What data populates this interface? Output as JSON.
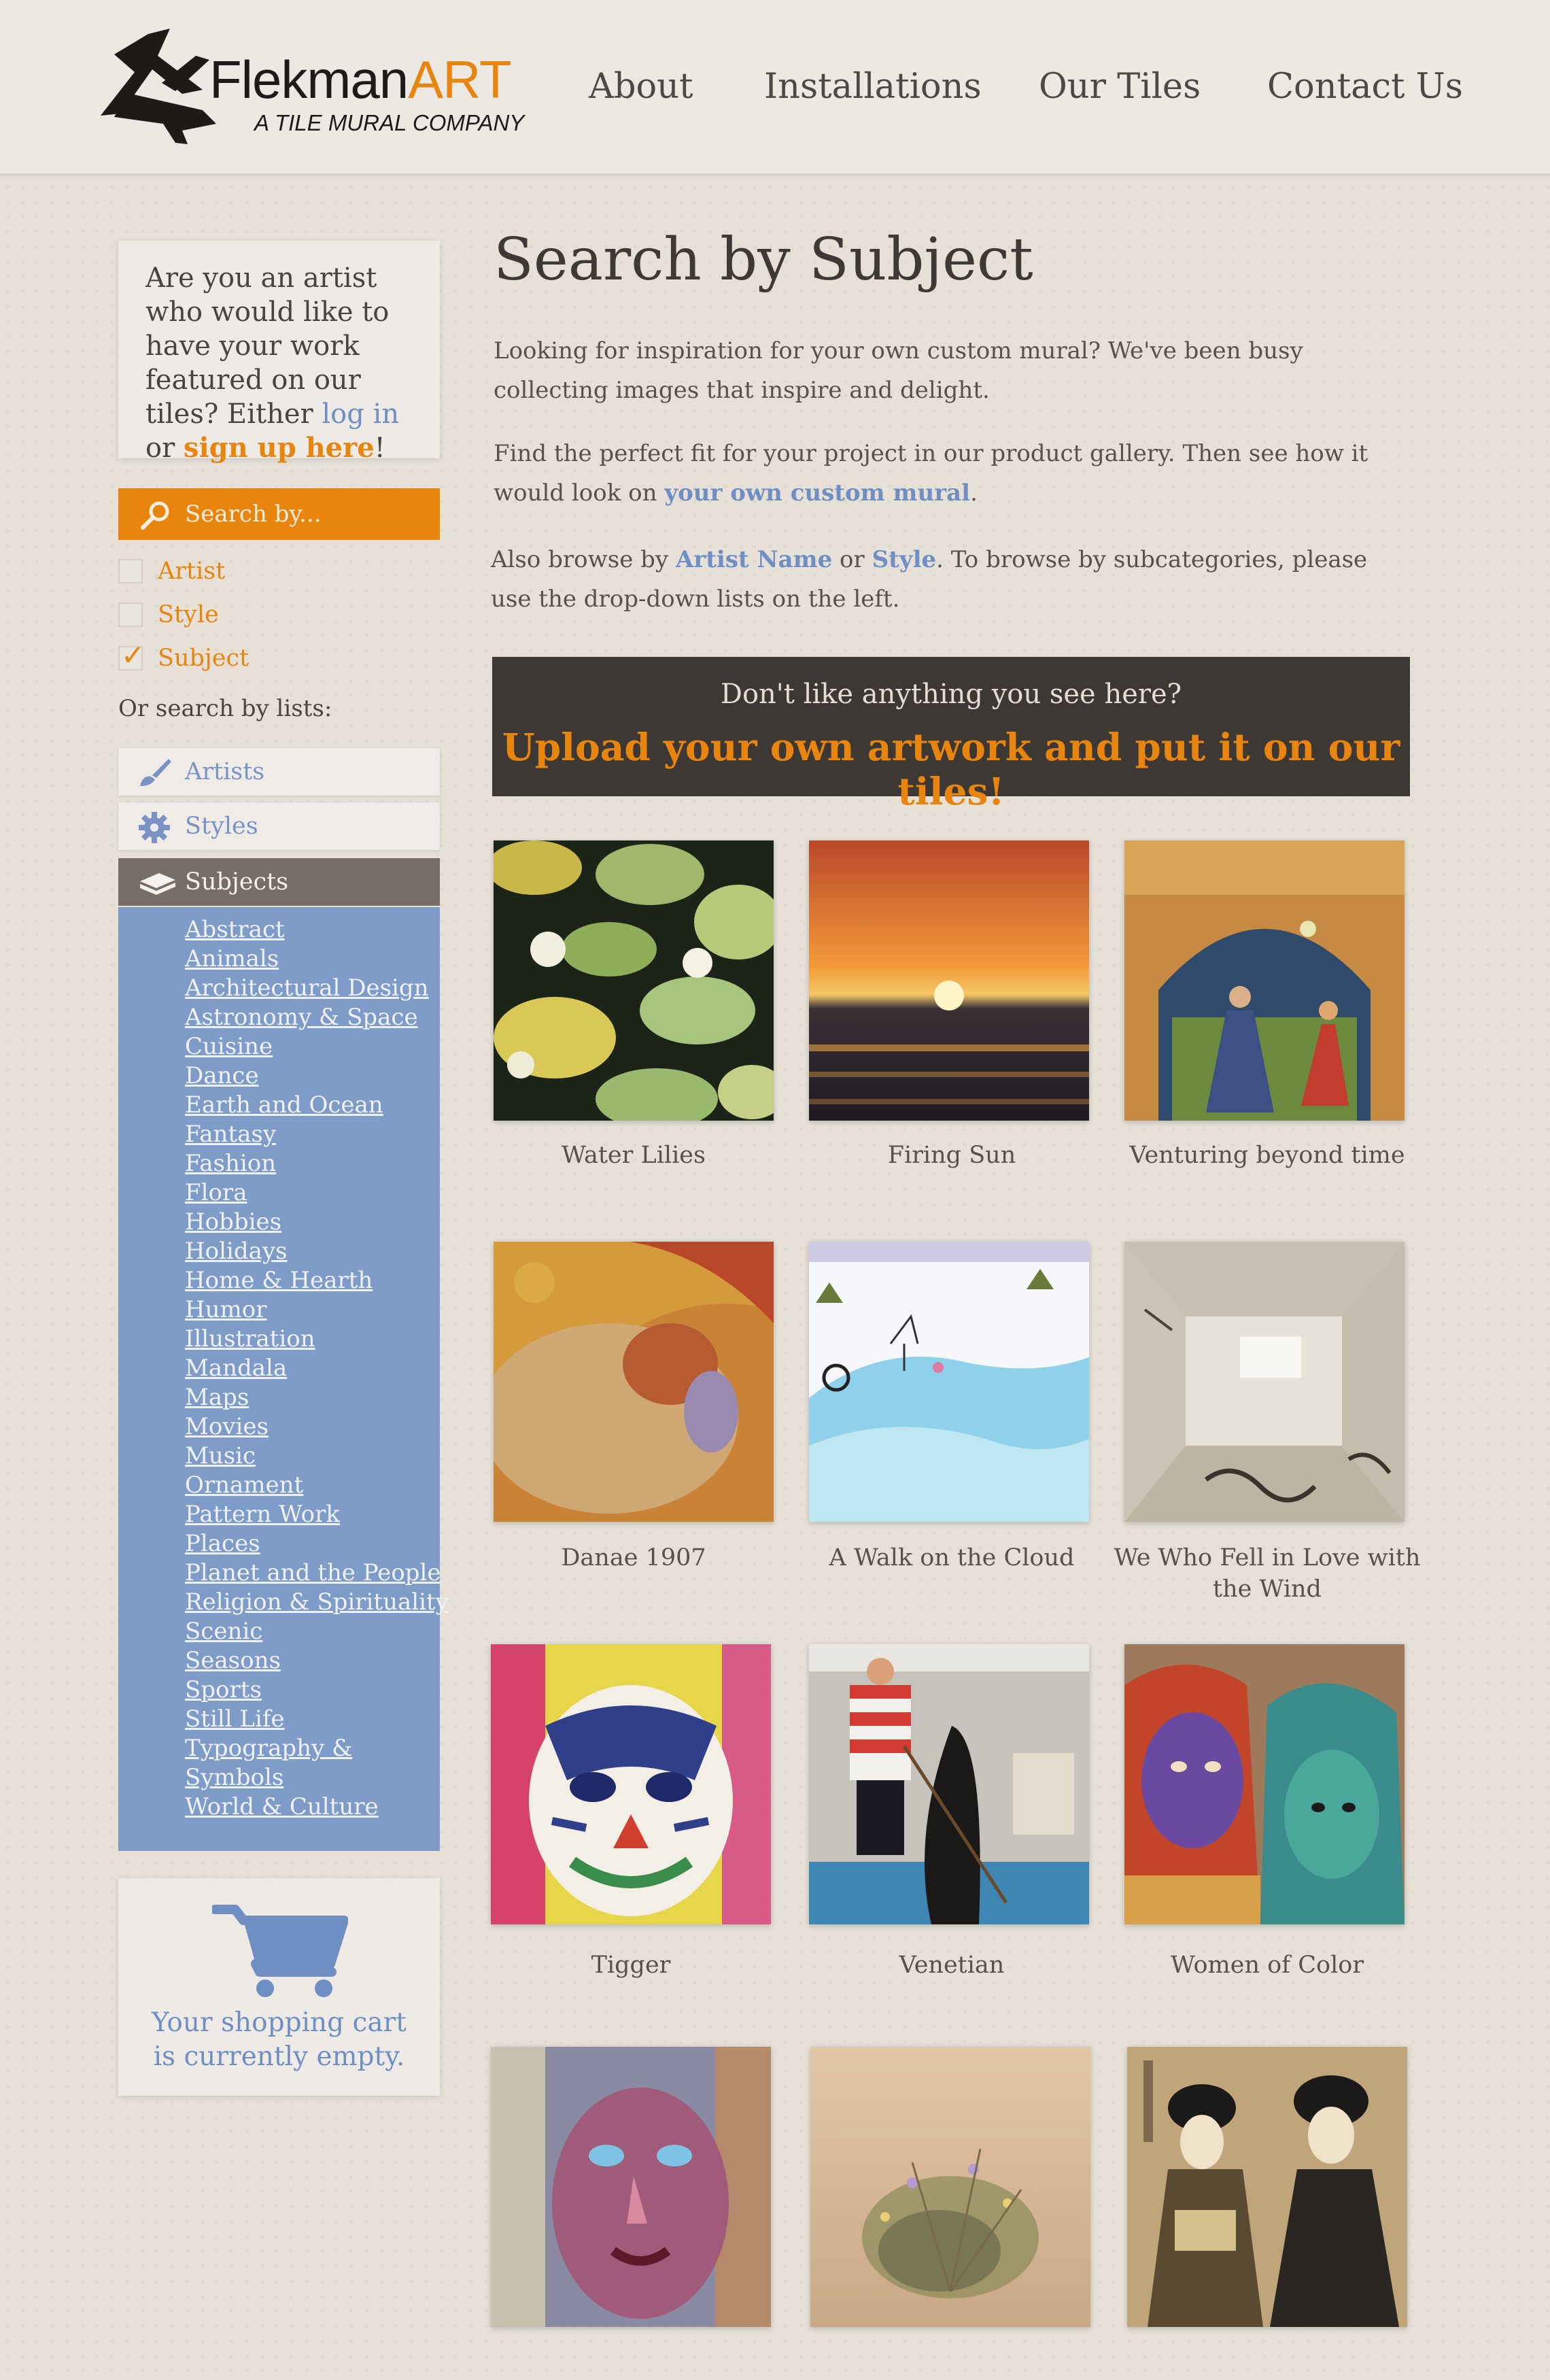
{
  "brand": {
    "name_part1": "Flekman",
    "name_part2": "ART",
    "tagline": "A TILE MURAL COMPANY"
  },
  "nav": {
    "items": [
      "About",
      "Installations",
      "Our Tiles",
      "Contact Us"
    ]
  },
  "artist_prompt": {
    "text_before": "Are you an artist who would like to have your work featured on our tiles? Either ",
    "login_link": "log in",
    "text_middle": " or ",
    "signup_link": "sign up here",
    "text_after": "!"
  },
  "search": {
    "label": "Search by...",
    "options": [
      {
        "label": "Artist",
        "checked": false
      },
      {
        "label": "Style",
        "checked": false
      },
      {
        "label": "Subject",
        "checked": true
      }
    ],
    "or_lists_label": "Or search by lists:",
    "list_tabs": [
      "Artists",
      "Styles",
      "Subjects"
    ],
    "active_tab": "Subjects"
  },
  "subjects": [
    "Abstract",
    "Animals",
    "Architectural Design",
    "Astronomy & Space",
    "Cuisine",
    "Dance",
    "Earth and Ocean",
    "Fantasy",
    "Fashion",
    "Flora",
    "Hobbies",
    "Holidays",
    "Home & Hearth",
    "Humor",
    "Illustration",
    "Mandala",
    "Maps",
    "Movies",
    "Music",
    "Ornament",
    "Pattern Work",
    "Places",
    "Planet and the People",
    "Religion & Spirituality",
    "Scenic",
    "Seasons",
    "Sports",
    "Still Life",
    "Typography &",
    "Symbols",
    "World & Culture"
  ],
  "cart": {
    "line1": "Your shopping cart",
    "line2": "is currently empty."
  },
  "main": {
    "title": "Search by Subject",
    "para1": "Looking for inspiration for your own custom mural? We've been busy collecting images that inspire and delight.",
    "para2_text": "Find the perfect fit for your project in our product gallery. Then see how it would look on ",
    "para2_link": "your own custom mural",
    "para2_end": ".",
    "para3_a": "Also browse by ",
    "para3_link1": "Artist Name",
    "para3_b": " or ",
    "para3_link2": "Style",
    "para3_c": ". To browse by subcategories, please use the drop-down lists on the left."
  },
  "upload_banner": {
    "question": "Don't like anything you see here?",
    "cta": "Upload your own artwork and put it on our tiles!"
  },
  "gallery": [
    {
      "title": "Water Lilies"
    },
    {
      "title": "Firing Sun"
    },
    {
      "title": "Venturing beyond time"
    },
    {
      "title": "Danae 1907"
    },
    {
      "title": "A Walk on the Cloud"
    },
    {
      "title": "We Who Fell in Love with the Wind"
    },
    {
      "title": "Tigger"
    },
    {
      "title": "Venetian"
    },
    {
      "title": "Women of Color"
    },
    {
      "title": ""
    },
    {
      "title": ""
    },
    {
      "title": ""
    }
  ],
  "colors": {
    "accent_orange": "#e8850f",
    "link_blue": "#6f8fc4",
    "panel_blue": "#7f9cc8",
    "dark_banner": "#3e3835"
  }
}
